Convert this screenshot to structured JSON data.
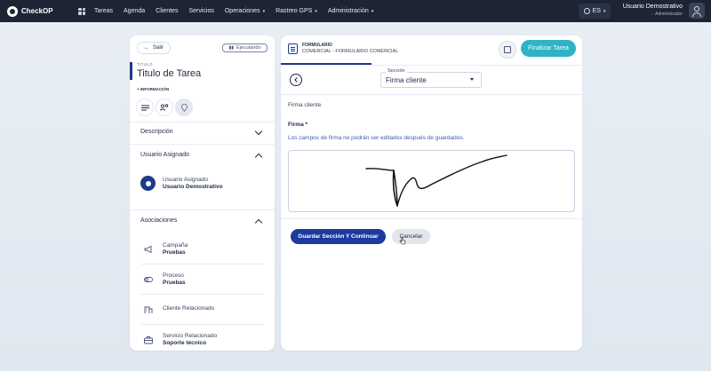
{
  "topnav": {
    "logo_text": "CheckOP",
    "items": [
      {
        "label": "Tareas",
        "dropdown": false
      },
      {
        "label": "Agenda",
        "dropdown": false
      },
      {
        "label": "Clientes",
        "dropdown": false
      },
      {
        "label": "Servicios",
        "dropdown": false
      },
      {
        "label": "Operaciones",
        "dropdown": true
      },
      {
        "label": "Rastreo GPS",
        "dropdown": true
      },
      {
        "label": "Administración",
        "dropdown": true
      }
    ],
    "language": "ES",
    "user_name": "Usuario Demostrativo",
    "user_role": "Administrador"
  },
  "left": {
    "back_label": "Salir",
    "status_label": "Ejecutando",
    "title_small": "TITULO",
    "title": "Titulo de Tarea",
    "info_label": "+ INFORMACIÓN",
    "sections": {
      "descripcion": "Descripción",
      "usuario": "Usuario Asignado",
      "asociaciones": "Asociaciones"
    },
    "assigned": {
      "label": "Usuario Asignado",
      "value": "Usuario Demostrativo"
    },
    "associations": [
      {
        "label": "Campaña",
        "value": "Pruebas",
        "icon": "megaphone-icon"
      },
      {
        "label": "Proceso",
        "value": "Pruebas",
        "icon": "toggle-icon"
      },
      {
        "label": "Cliente Relacionado",
        "value": "",
        "icon": "building-icon"
      },
      {
        "label": "Servicio Relacionado",
        "value": "Soporte técnico",
        "icon": "briefcase-icon"
      }
    ]
  },
  "main": {
    "form_title": "FORMULARIO",
    "form_subtitle": "COMERCIAL - FORMULARIO COMERCIAL",
    "finish_label": "Finalizar Tarea",
    "section_label": "Sección",
    "section_value": "Firma cliente",
    "crumb": "Firma cliente",
    "field_label": "Firma *",
    "field_note": "Los campos de firma no podrán ser editados después de guardados.",
    "primary_button": "Guardar Sección Y Continuar",
    "cancel_button": "Cancelar"
  },
  "colors": {
    "nav_bg": "#1d2433",
    "primary": "#1d3a9e",
    "accent": "#2fb3c5"
  }
}
